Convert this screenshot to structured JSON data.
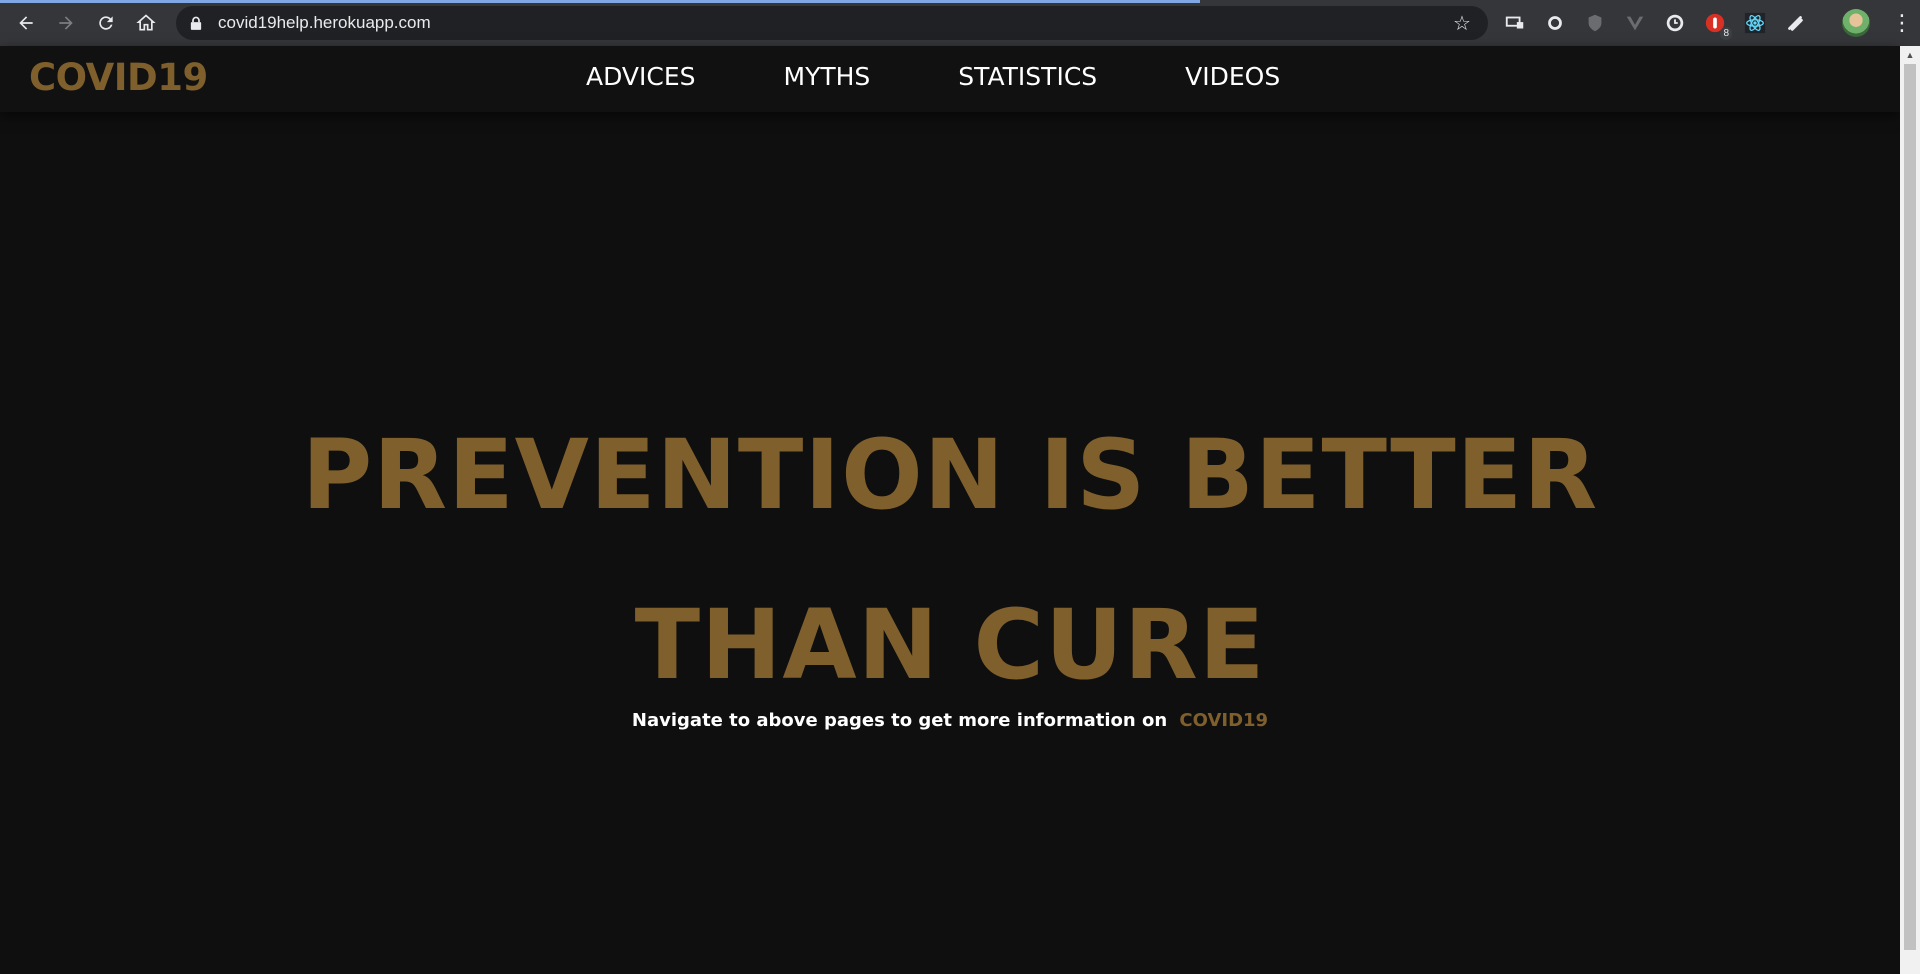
{
  "browser": {
    "url": "covid19help.herokuapp.com",
    "extension_badge": "8"
  },
  "site": {
    "logo": "COVID19",
    "nav": [
      "ADVICES",
      "MYTHS",
      "STATISTICS",
      "VIDEOS"
    ],
    "hero": {
      "line1": "PREVENTION IS BETTER",
      "line2": "THAN CURE",
      "subtitle": "Navigate to above pages to get more information on",
      "subtitle_accent": "COVID19"
    }
  },
  "colors": {
    "accent": "#7f5f2c",
    "background": "#0f0f0f",
    "nav_background": "#111111",
    "text": "#ffffff"
  }
}
